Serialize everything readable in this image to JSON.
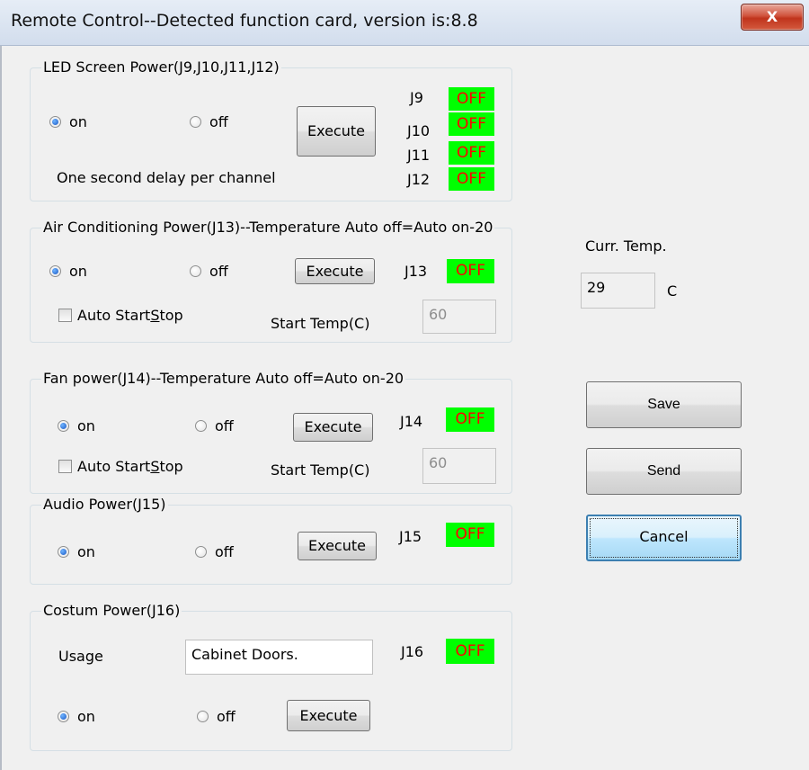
{
  "window": {
    "title": "Remote Control--Detected function card, version is:8.8",
    "close_icon": "x-close-icon",
    "close_glyph": "X"
  },
  "led_group": {
    "title": "LED Screen Power(J9,J10,J11,J12)",
    "on_label": "on",
    "off_label": "off",
    "execute_label": "Execute",
    "note": "One second delay per channel",
    "selected": "on",
    "channels": [
      {
        "label": "J9",
        "status": "OFF"
      },
      {
        "label": "J10",
        "status": "OFF"
      },
      {
        "label": "J11",
        "status": "OFF"
      },
      {
        "label": "J12",
        "status": "OFF"
      }
    ]
  },
  "ac_group": {
    "title": "Air Conditioning Power(J13)--Temperature Auto off=Auto on-20",
    "on_label": "on",
    "off_label": "off",
    "execute_label": "Execute",
    "channel_label": "J13",
    "status": "OFF",
    "auto_label_pre": "Auto Start",
    "auto_label_u": "S",
    "auto_label_post": "top",
    "start_temp_label": "Start Temp(C)",
    "start_temp_value": "60",
    "selected": "on"
  },
  "fan_group": {
    "title": "Fan power(J14)--Temperature Auto off=Auto on-20",
    "on_label": "on",
    "off_label": "off",
    "execute_label": "Execute",
    "channel_label": "J14",
    "status": "OFF",
    "auto_label_pre": "Auto Start",
    "auto_label_u": "S",
    "auto_label_post": "top",
    "start_temp_label": "Start Temp(C)",
    "start_temp_value": "60",
    "selected": "on"
  },
  "audio_group": {
    "title": "Audio Power(J15)",
    "on_label": "on",
    "off_label": "off",
    "execute_label": "Execute",
    "channel_label": "J15",
    "status": "OFF",
    "selected": "on"
  },
  "custom_group": {
    "title": "Costum Power(J16)",
    "usage_label": "Usage",
    "usage_value": "Cabinet Doors.",
    "on_label": "on",
    "off_label": "off",
    "execute_label": "Execute",
    "channel_label": "J16",
    "status": "OFF",
    "selected": "on"
  },
  "temperature": {
    "label": "Curr. Temp.",
    "value": "29",
    "unit": "C"
  },
  "actions": {
    "save_label": "Save",
    "send_label": "Send",
    "cancel_label": "Cancel"
  },
  "colors": {
    "status_bg": "#00ff00",
    "status_text": "#ff0000",
    "close_button": "#c7432a"
  }
}
